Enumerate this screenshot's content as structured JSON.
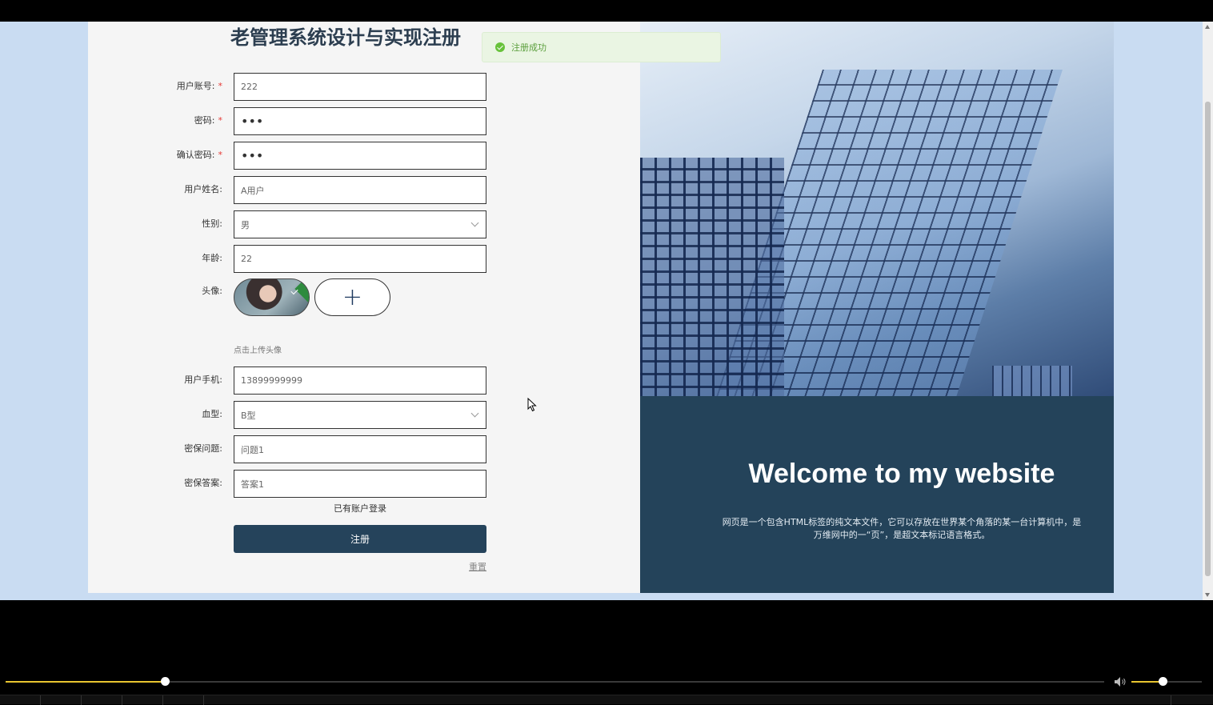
{
  "form": {
    "title": "老管理系统设计与实现注册",
    "fields": [
      {
        "label": "用户账号:",
        "value": "222",
        "required": true
      },
      {
        "label": "密码:",
        "value": "•••",
        "required": true
      },
      {
        "label": "确认密码:",
        "value": "•••",
        "required": true
      },
      {
        "label": "用户姓名:",
        "value": "A用户",
        "required": false
      },
      {
        "label": "性别:",
        "value": "男",
        "required": false
      },
      {
        "label": "年龄:",
        "value": "22",
        "required": false
      }
    ],
    "avatar_label": "头像:",
    "upload_hint": "点击上传头像",
    "fields2": [
      {
        "label": "用户手机:",
        "value": "13899999999"
      },
      {
        "label": "血型:",
        "value": "B型"
      },
      {
        "label": "密保问题:",
        "value": "问题1"
      },
      {
        "label": "密保答案:",
        "value": "答案1"
      }
    ],
    "required_mark": "*",
    "login_link": "已有账户登录",
    "register_button": "注册",
    "reset_link": "重置",
    "upload_plus": "+"
  },
  "welcome": {
    "title": "Welcome to my website",
    "description": "网页是一个包含HTML标签的纯文本文件，它可以存放在世界某个角落的某一台计算机中，是万维网中的一“页”，是超文本标记语言格式。"
  },
  "toast": {
    "message": "注册成功",
    "color": "#67c23a"
  },
  "player": {
    "seek_progress": 0.145,
    "volume_level": 0.44,
    "accent_color": "#e8c530"
  },
  "colors": {
    "primary": "#25435b",
    "background": "#c9dcf2"
  }
}
